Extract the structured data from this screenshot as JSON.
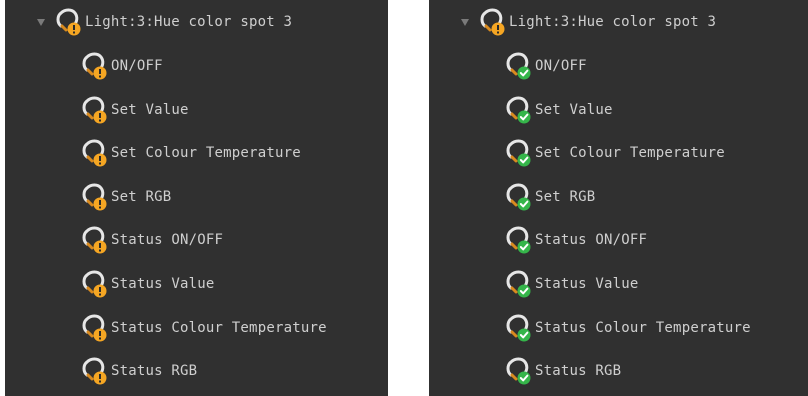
{
  "panels": [
    {
      "header": {
        "label": "Light:3:Hue color spot 3",
        "status": "warning"
      },
      "items": [
        {
          "label": "ON/OFF",
          "status": "warning"
        },
        {
          "label": "Set Value",
          "status": "warning"
        },
        {
          "label": "Set Colour Temperature",
          "status": "warning"
        },
        {
          "label": "Set RGB",
          "status": "warning"
        },
        {
          "label": "Status ON/OFF",
          "status": "warning"
        },
        {
          "label": "Status Value",
          "status": "warning"
        },
        {
          "label": "Status Colour Temperature",
          "status": "warning"
        },
        {
          "label": "Status RGB",
          "status": "warning"
        }
      ]
    },
    {
      "header": {
        "label": "Light:3:Hue color spot 3",
        "status": "warning"
      },
      "items": [
        {
          "label": "ON/OFF",
          "status": "ok"
        },
        {
          "label": "Set Value",
          "status": "ok"
        },
        {
          "label": "Set Colour Temperature",
          "status": "ok"
        },
        {
          "label": "Set RGB",
          "status": "ok"
        },
        {
          "label": "Status ON/OFF",
          "status": "ok"
        },
        {
          "label": "Status Value",
          "status": "ok"
        },
        {
          "label": "Status Colour Temperature",
          "status": "ok"
        },
        {
          "label": "Status RGB",
          "status": "ok"
        }
      ]
    }
  ],
  "icons": {
    "bulb": "lightbulb-icon",
    "warning": "warning-badge-icon",
    "ok": "checkmark-badge-icon",
    "expand": "expand-arrow-icon"
  },
  "colors": {
    "panel_bg": "#303030",
    "text": "#cfcfcf",
    "bulb": "#e6e6e6",
    "bulb_base": "#d98a1e",
    "warning": "#f5a623",
    "ok": "#35b54a"
  }
}
